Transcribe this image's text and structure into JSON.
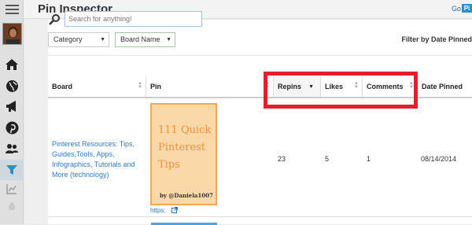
{
  "app": {
    "title": "Pin Inspector",
    "go_label": "Go",
    "go_badge": "Pi"
  },
  "search": {
    "placeholder": "Search for anything!"
  },
  "sidebar": {
    "icons": [
      "home-icon",
      "globe-icon",
      "megaphone-icon",
      "pinterest-icon",
      "users-icon",
      "filter-icon",
      "chart-icon",
      "fire-icon"
    ]
  },
  "filters": {
    "category_label": "Category",
    "board_label": "Board Name",
    "date_filter_label": "Filter by Date Pinned"
  },
  "table": {
    "columns": [
      "Board",
      "Pin",
      "Repins",
      "Likes",
      "Comments",
      "Date Pinned"
    ],
    "rows": [
      {
        "board": "Pinterest Resources: Tips, Guides,Tools, Apps, Infographics, Tutorials and More (technology)",
        "pin_title": "111 Quick Pinterest Tips",
        "pin_credit": "by @Daniela1007",
        "pin_link": "https:",
        "repins": "23",
        "likes": "5",
        "comments": "1",
        "date_pinned": "08/14/2014"
      }
    ]
  },
  "colors": {
    "highlight": "#e3202a",
    "active_sort": "#4cba5b",
    "link": "#2d7bbf"
  }
}
